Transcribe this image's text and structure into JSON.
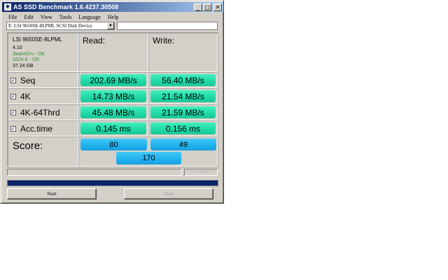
{
  "window": {
    "title": "AS SSD Benchmark 1.6.4237.30508",
    "controls": {
      "minimize": "_",
      "maximize": "□",
      "close": "✕"
    }
  },
  "menu": [
    "File",
    "Edit",
    "View",
    "Tools",
    "Language",
    "Help"
  ],
  "drive_select": {
    "value": "E: LSI 9650SE-8LPML SCSI Disk Device"
  },
  "aux_input": {
    "value": ""
  },
  "device_info": {
    "name": "LSI 9650SE-8LPML",
    "firmware": "4.10",
    "driver_status": "3wareDrv - OK",
    "alignment_status": "1024 K - OK",
    "capacity": "37.24 GB"
  },
  "headers": {
    "read": "Read:",
    "write": "Write:"
  },
  "tests": [
    {
      "label": "Seq",
      "checked": true,
      "read": "202.69 MB/s",
      "write": "56.40 MB/s"
    },
    {
      "label": "4K",
      "checked": true,
      "read": "14.73 MB/s",
      "write": "21.54 MB/s"
    },
    {
      "label": "4K-64Thrd",
      "checked": true,
      "read": "45.48 MB/s",
      "write": "21.59 MB/s"
    },
    {
      "label": "Acc.time",
      "checked": true,
      "read": "0.145 ms",
      "write": "0.156 ms"
    }
  ],
  "score": {
    "label": "Score:",
    "read": "80",
    "write": "49",
    "total": "170"
  },
  "status": {
    "text": "",
    "time": "-:--:--"
  },
  "progress": {
    "fraction": 1.0,
    "color": "#0a246a"
  },
  "buttons": {
    "start": "Start",
    "abort": "Abort"
  },
  "colors": {
    "value_box": "#20d8a4",
    "score_box": "#20b0ec",
    "title_bar": "#0a246a"
  }
}
